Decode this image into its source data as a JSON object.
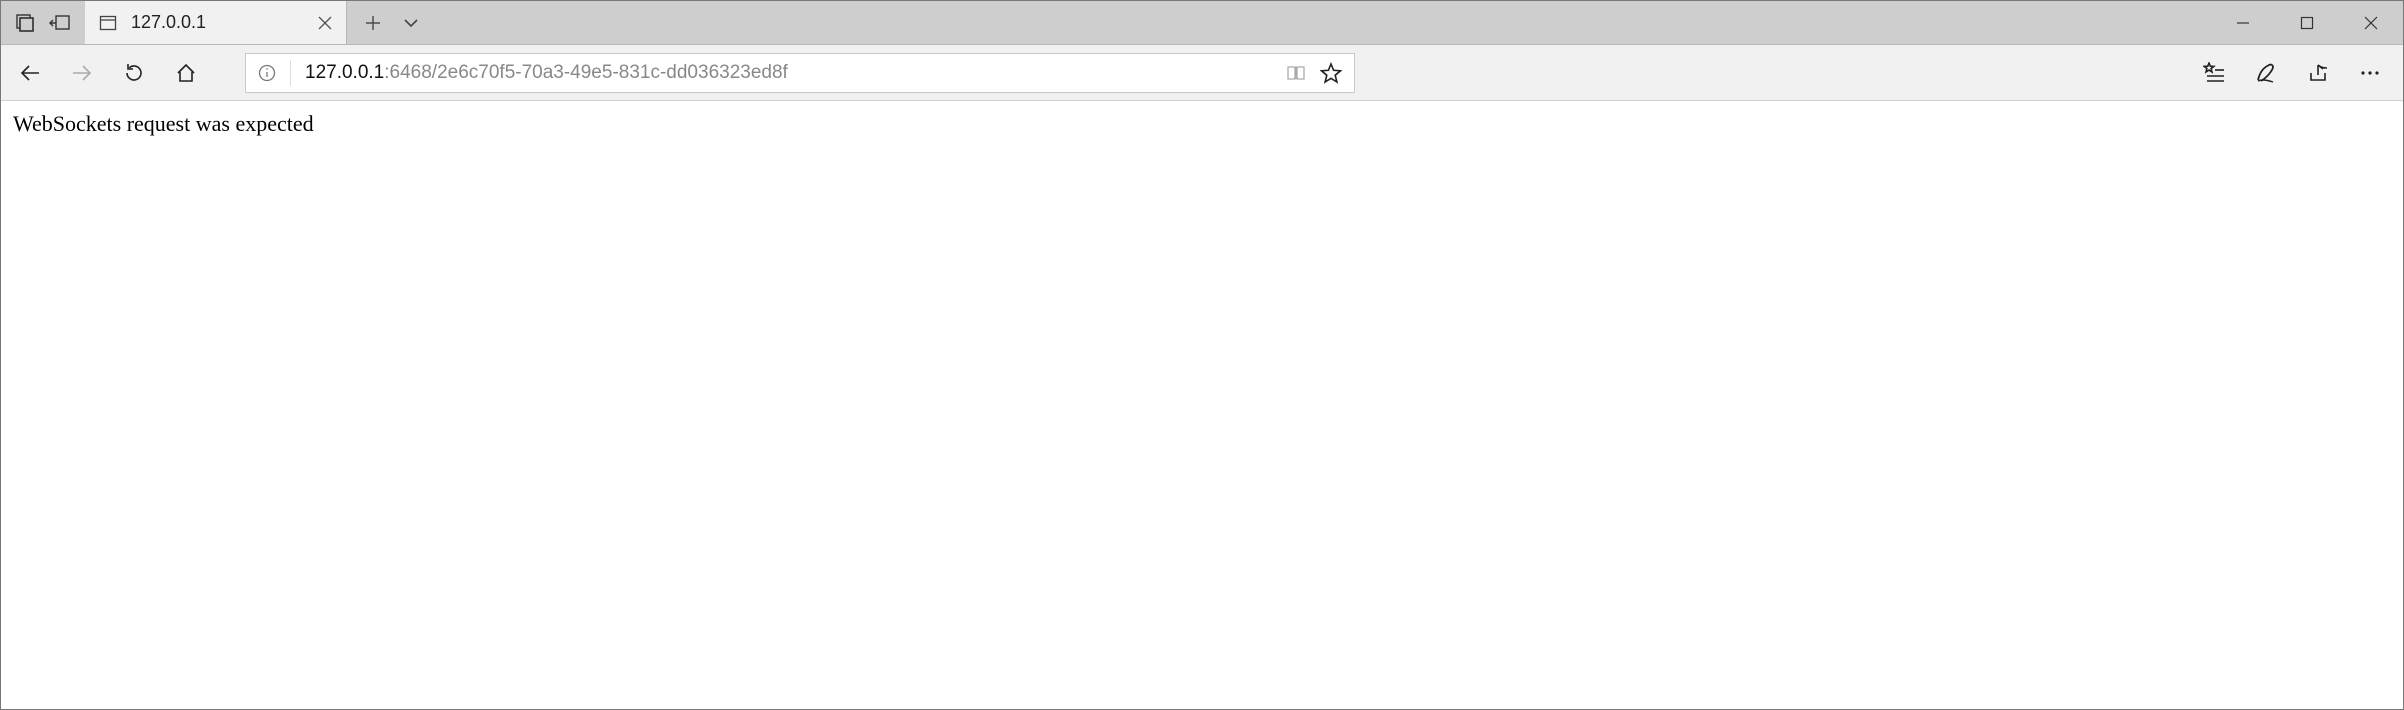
{
  "tab": {
    "title": "127.0.0.1"
  },
  "url": {
    "host": "127.0.0.1",
    "rest": ":6468/2e6c70f5-70a3-49e5-831c-dd036323ed8f"
  },
  "page": {
    "body_text": "WebSockets request was expected"
  }
}
